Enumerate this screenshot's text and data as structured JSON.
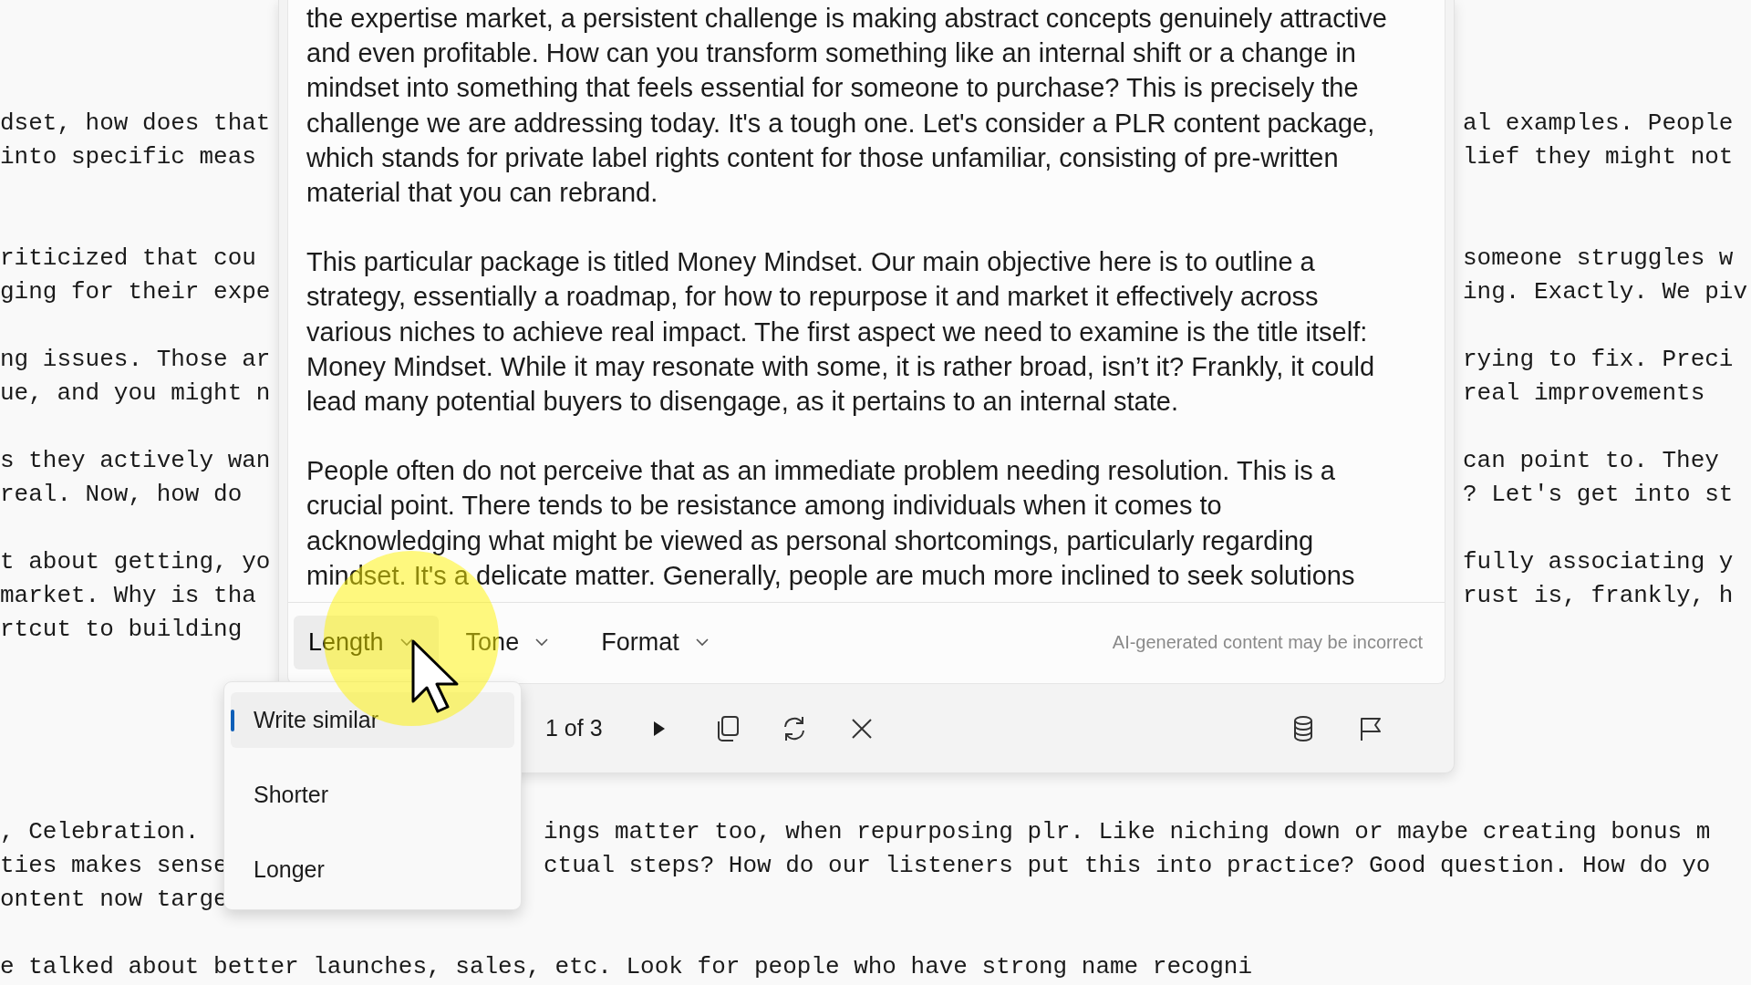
{
  "editor": {
    "top_paragraphs": [
      {
        "lines": [
          {
            "left": "dset, how does that",
            "right": "al examples. People"
          },
          {
            "left": "into specific meas",
            "right": "lief they might not"
          }
        ]
      },
      {
        "lines": [
          {
            "left": "riticized that cou",
            "right": "someone struggles w"
          },
          {
            "left": "ging for their expe",
            "right": "ing. Exactly. We piv"
          }
        ]
      },
      {
        "lines": [
          {
            "left": "ng issues. Those ar",
            "right": "rying to fix. Preci"
          },
          {
            "left": "ue, and you might n",
            "right": "real improvements"
          }
        ]
      },
      {
        "lines": [
          {
            "left": "s they actively wan",
            "right": "can point to. They"
          },
          {
            "left": "real. Now, how do",
            "right": "? Let's get into st"
          }
        ]
      },
      {
        "lines": [
          {
            "left": "t about getting, yo",
            "right": "fully associating y"
          },
          {
            "left": "market. Why is tha",
            "right": "rust is, frankly, h"
          },
          {
            "left": "rtcut to building"
          }
        ]
      }
    ],
    "bottom_paragraphs": [
      {
        "lines": [
          {
            "left": ", Celebration.",
            "middle": "ings matter too, when repurposing plr. Like niching down or maybe creating bonus m"
          },
          {
            "left": "ties makes sense",
            "middle": "ctual steps? How do our listeners put this into practice? Good question. How do yo"
          },
          {
            "left": "ontent now targe"
          }
        ]
      },
      {
        "lines": [
          {
            "left": "e talked about better launches, sales, etc. Look for people who have strong name recogni"
          }
        ]
      }
    ]
  },
  "rewrite_panel": {
    "paragraphs": [
      {
        "lines": [
          "the expertise market, a persistent challenge is making abstract concepts genuinely attractive",
          "and even profitable. How can you transform something like an internal shift or a change in",
          "mindset into something that feels essential for someone to purchase? This is precisely the",
          "challenge we are addressing today. It's a tough one. Let's consider a PLR content package,",
          "which stands for private label rights content for those unfamiliar, consisting of pre-written",
          "material that you can rebrand."
        ]
      },
      {
        "lines": [
          "This particular package is titled Money Mindset. Our main objective here is to outline a",
          "strategy, essentially a roadmap, for how to repurpose it and market it effectively across",
          "various niches to achieve real impact. The first aspect we need to examine is the title itself:",
          "Money Mindset. While it may resonate with some, it is rather broad, isn’t it? Frankly, it could",
          "lead many potential buyers to disengage, as it pertains to an internal state."
        ]
      },
      {
        "lines": [
          "People often do not perceive that as an immediate problem needing resolution. This is a",
          "crucial point. There tends to be resistance among individuals when it comes to",
          "acknowledging what might be viewed as personal shortcomings, particularly regarding",
          "mindset. It's a delicate matter. Generally, people are much more inclined to seek solutions"
        ]
      }
    ],
    "options": [
      {
        "label": "Length",
        "selected": true
      },
      {
        "label": "Tone",
        "selected": false
      },
      {
        "label": "Format",
        "selected": false
      }
    ],
    "disclaimer": "AI-generated content may be incorrect",
    "counter": "1 of 3"
  },
  "menu": {
    "items": [
      {
        "label": "Write similar",
        "selected": true
      },
      {
        "label": "Shorter",
        "selected": false
      },
      {
        "label": "Longer",
        "selected": false
      }
    ]
  }
}
